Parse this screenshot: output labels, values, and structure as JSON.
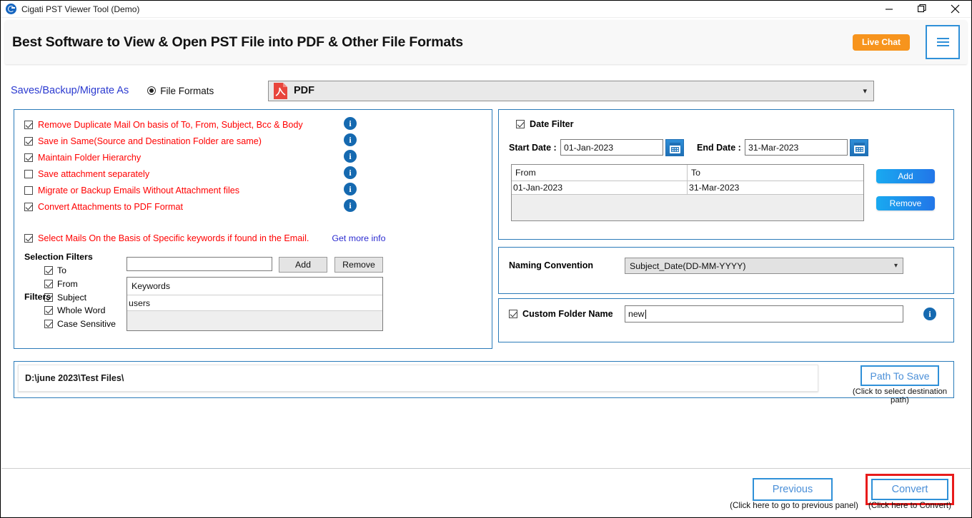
{
  "window": {
    "title": "Cigati PST Viewer Tool (Demo)",
    "icon": "app-logo-icon",
    "controls": {
      "minimize": "minimize-icon",
      "maximize": "maximize-icon",
      "close": "close-icon"
    }
  },
  "header": {
    "title": "Best Software to View & Open PST File into PDF & Other File Formats",
    "live_chat": "Live Chat",
    "menu": "hamburger-menu-icon",
    "accent_orange": "#f7941d",
    "accent_blue": "#2f90d8"
  },
  "format_row": {
    "saves_label": "Saves/Backup/Migrate As",
    "radio_label": "File Formats",
    "radio_selected": true,
    "selected_format": "PDF",
    "format_icon": "pdf-file-icon",
    "caret": "chevron-down-icon"
  },
  "options": [
    {
      "label": "Remove Duplicate Mail On basis of To, From, Subject, Bcc & Body",
      "checked": true,
      "info": "info-icon"
    },
    {
      "label": "Save in Same(Source and Destination Folder are same)",
      "checked": true,
      "info": "info-icon"
    },
    {
      "label": "Maintain Folder Hierarchy",
      "checked": true,
      "info": "info-icon"
    },
    {
      "label": "Save attachment separately",
      "checked": false,
      "info": "info-icon"
    },
    {
      "label": "Migrate or Backup Emails Without Attachment files",
      "checked": false,
      "info": "info-icon"
    },
    {
      "label": "Convert Attachments to PDF Format",
      "checked": true,
      "info": "info-icon"
    }
  ],
  "select_mails": {
    "label": "Select Mails On the Basis of Specific keywords if found in the Email.",
    "checked": true,
    "get_more_info": "Get more info",
    "selection_filters_title": "Selection Filters",
    "selection_filters": [
      {
        "label": "To",
        "checked": true
      },
      {
        "label": "From",
        "checked": true
      },
      {
        "label": "Subject",
        "checked": true
      }
    ],
    "filters_title": "Filters",
    "filters": [
      {
        "label": "Whole Word",
        "checked": true
      },
      {
        "label": "Case Sensitive",
        "checked": true
      }
    ],
    "keyword_input_value": "",
    "keyword_input_placeholder": "",
    "add_label": "Add",
    "remove_label": "Remove",
    "keywords_column": "Keywords",
    "keywords": [
      "users"
    ]
  },
  "date_filter": {
    "title": "Date Filter",
    "checked": true,
    "start_label": "Start Date :",
    "start_value": "01-Jan-2023",
    "end_label": "End Date :",
    "end_value": "31-Mar-2023",
    "calendar_icon": "calendar-icon",
    "columns": [
      "From",
      "To"
    ],
    "rows": [
      {
        "from": "01-Jan-2023",
        "to": "31-Mar-2023"
      }
    ],
    "add_label": "Add",
    "remove_label": "Remove"
  },
  "naming": {
    "label": "Naming Convention",
    "value": "Subject_Date(DD-MM-YYYY)",
    "caret": "chevron-down-icon"
  },
  "custom_folder": {
    "label": "Custom Folder Name",
    "checked": true,
    "value": "new",
    "info": "info-icon"
  },
  "path": {
    "value": "D:\\june 2023\\Test Files\\",
    "button_label": "Path To Save",
    "button_hint": "(Click to select destination path)"
  },
  "footer": {
    "previous_label": "Previous",
    "previous_hint": "(Click here to go to previous panel)",
    "convert_label": "Convert",
    "convert_hint": "(Click here to Convert)",
    "highlight_color": "#e81b1b"
  }
}
